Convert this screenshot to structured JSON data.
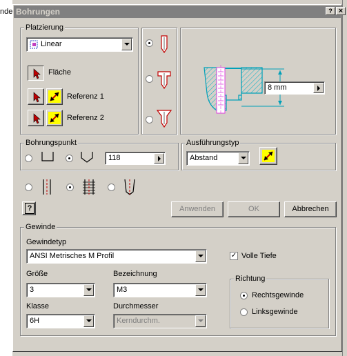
{
  "background": {
    "left_text": "nde"
  },
  "window": {
    "title": "Bohrungen",
    "help_btn": "?",
    "close_btn": "×"
  },
  "placement": {
    "group_label": "Platzierung",
    "type_value": "Linear",
    "surface_label": "Fläche",
    "reference1_label": "Referenz 1",
    "reference2_label": "Referenz 2"
  },
  "preview": {
    "depth_value": "8 mm"
  },
  "drill_point": {
    "group_label": "Bohrungspunkt",
    "angle_value": "118"
  },
  "termination": {
    "group_label": "Ausführungstyp",
    "type_value": "Abstand"
  },
  "actions": {
    "help_icon_text": "?",
    "apply": "Anwenden",
    "ok": "OK",
    "cancel": "Abbrechen"
  },
  "thread": {
    "group_label": "Gewinde",
    "type_label": "Gewindetyp",
    "type_value": "ANSI Metrisches M Profil",
    "full_depth_label": "Volle Tiefe",
    "full_depth_checked": true,
    "size_label": "Größe",
    "size_value": "3",
    "designation_label": "Bezeichnung",
    "designation_value": "M3",
    "class_label": "Klasse",
    "class_value": "6H",
    "diameter_label": "Durchmesser",
    "diameter_value": "Kerndurchm.",
    "direction_label": "Richtung",
    "right_hand_label": "Rechtsgewinde",
    "left_hand_label": "Linksgewinde"
  },
  "colors": {
    "dialog_bg": "#d4d0c8",
    "hatch_cyan": "#00b0c8",
    "thread_magenta": "#e040e0",
    "arrow_yellow": "#ffff00",
    "arrow_red": "#c00000"
  }
}
